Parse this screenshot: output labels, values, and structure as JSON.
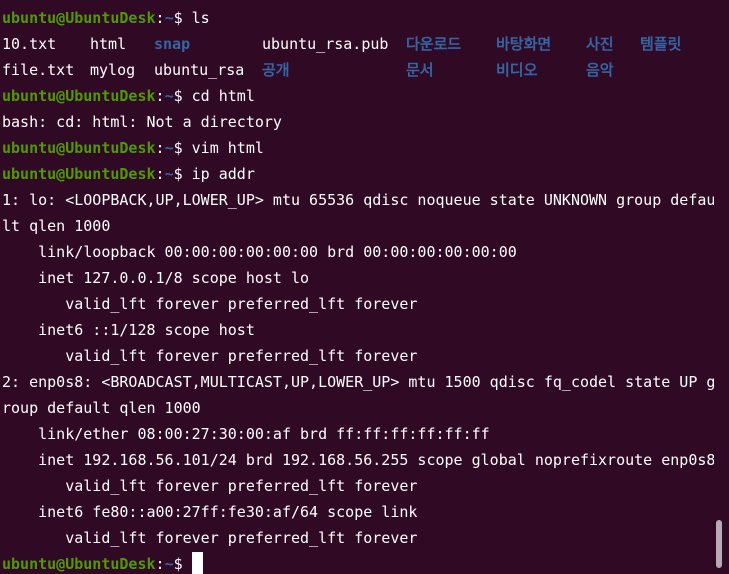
{
  "prompt": {
    "user_host": "ubuntu@UbuntuDesk",
    "colon": ":",
    "path": "~",
    "symbol": "$ "
  },
  "lines": [
    {
      "type": "prompt",
      "command": "ls"
    },
    {
      "type": "ls",
      "items": [
        {
          "text": "10.txt",
          "kind": "file"
        },
        {
          "text": "html",
          "kind": "file"
        },
        {
          "text": "snap",
          "kind": "dir"
        },
        {
          "text": "ubuntu_rsa.pub",
          "kind": "file"
        },
        {
          "text": "다운로드",
          "kind": "dir"
        },
        {
          "text": "바탕화면",
          "kind": "dir"
        },
        {
          "text": "사진",
          "kind": "dir"
        },
        {
          "text": "템플릿",
          "kind": "dir"
        }
      ]
    },
    {
      "type": "ls",
      "items": [
        {
          "text": "file.txt",
          "kind": "file"
        },
        {
          "text": "mylog",
          "kind": "file"
        },
        {
          "text": "ubuntu_rsa",
          "kind": "file"
        },
        {
          "text": "공개",
          "kind": "dir"
        },
        {
          "text": "문서",
          "kind": "dir"
        },
        {
          "text": "비디오",
          "kind": "dir"
        },
        {
          "text": "음악",
          "kind": "dir"
        }
      ]
    },
    {
      "type": "prompt",
      "command": "cd html"
    },
    {
      "type": "output",
      "text": "bash: cd: html: Not a directory"
    },
    {
      "type": "prompt",
      "command": "vim html"
    },
    {
      "type": "prompt",
      "command": "ip addr"
    },
    {
      "type": "output",
      "text": "1: lo: <LOOPBACK,UP,LOWER_UP> mtu 65536 qdisc noqueue state UNKNOWN group defau"
    },
    {
      "type": "output",
      "text": "lt qlen 1000"
    },
    {
      "type": "output",
      "text": "    link/loopback 00:00:00:00:00:00 brd 00:00:00:00:00:00"
    },
    {
      "type": "output",
      "text": "    inet 127.0.0.1/8 scope host lo"
    },
    {
      "type": "output",
      "text": "       valid_lft forever preferred_lft forever"
    },
    {
      "type": "output",
      "text": "    inet6 ::1/128 scope host"
    },
    {
      "type": "output",
      "text": "       valid_lft forever preferred_lft forever"
    },
    {
      "type": "output",
      "text": "2: enp0s8: <BROADCAST,MULTICAST,UP,LOWER_UP> mtu 1500 qdisc fq_codel state UP g"
    },
    {
      "type": "output",
      "text": "roup default qlen 1000"
    },
    {
      "type": "output",
      "text": "    link/ether 08:00:27:30:00:af brd ff:ff:ff:ff:ff:ff"
    },
    {
      "type": "output",
      "text": "    inet 192.168.56.101/24 brd 192.168.56.255 scope global noprefixroute enp0s8"
    },
    {
      "type": "output",
      "text": "       valid_lft forever preferred_lft forever"
    },
    {
      "type": "output",
      "text": "    inet6 fe80::a00:27ff:fe30:af/64 scope link"
    },
    {
      "type": "output",
      "text": "       valid_lft forever preferred_lft forever"
    },
    {
      "type": "prompt",
      "command": "",
      "cursor": true
    }
  ],
  "colors": {
    "background": "#300a24",
    "user": "#4e9a06",
    "path": "#3465a4",
    "text": "#ffffff"
  }
}
